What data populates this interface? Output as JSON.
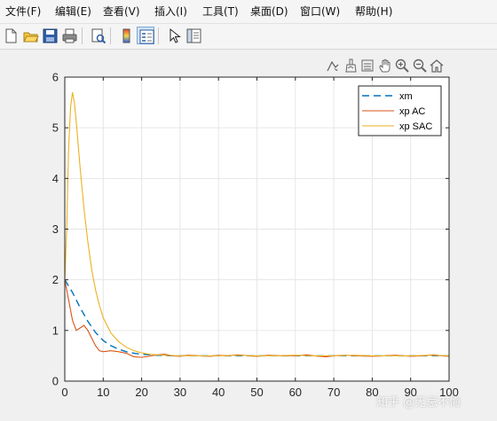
{
  "menu": {
    "items": [
      {
        "label": "文件(F)",
        "name": "menu-file"
      },
      {
        "label": "编辑(E)",
        "name": "menu-edit"
      },
      {
        "label": "查看(V)",
        "name": "menu-view"
      },
      {
        "label": "插入(I)",
        "name": "menu-insert"
      },
      {
        "label": "工具(T)",
        "name": "menu-tools"
      },
      {
        "label": "桌面(D)",
        "name": "menu-desktop"
      },
      {
        "label": "窗口(W)",
        "name": "menu-window"
      },
      {
        "label": "帮助(H)",
        "name": "menu-help"
      }
    ]
  },
  "toolbar": {
    "buttons": [
      "new-figure-icon",
      "open-file-icon",
      "save-icon",
      "print-icon",
      "print-preview-icon",
      "colorbar-icon",
      "legend-icon",
      "pointer-icon",
      "property-inspector-icon"
    ]
  },
  "axes_toolbar": {
    "buttons": [
      "data-cursor-icon",
      "brush-icon",
      "link-data-icon",
      "pan-hand-icon",
      "zoom-in-icon",
      "zoom-out-icon",
      "home-icon"
    ]
  },
  "watermark": {
    "text": "知乎 @无忌不悔"
  },
  "colors": {
    "xm": "#0072bd",
    "xp_ac": "#d95319",
    "xp_sac": "#edb120",
    "grid": "#e6e6e6",
    "axes": "#262626"
  },
  "chart_data": {
    "type": "line",
    "title": "",
    "xlabel": "",
    "ylabel": "",
    "xlim": [
      0,
      100
    ],
    "ylim": [
      0,
      6
    ],
    "xticks": [
      0,
      10,
      20,
      30,
      40,
      50,
      60,
      70,
      80,
      90,
      100
    ],
    "yticks": [
      0,
      1,
      2,
      3,
      4,
      5,
      6
    ],
    "grid": true,
    "legend_position": "top-right",
    "series": [
      {
        "name": "xm",
        "style": "dashed",
        "color": "#0072bd",
        "x": [
          0,
          2,
          4,
          6,
          8,
          10,
          12,
          14,
          16,
          18,
          20,
          22,
          24,
          26,
          28,
          30,
          35,
          40,
          50,
          60,
          70,
          80,
          90,
          100
        ],
        "y": [
          2.0,
          1.75,
          1.45,
          1.18,
          0.96,
          0.8,
          0.7,
          0.63,
          0.58,
          0.55,
          0.53,
          0.52,
          0.51,
          0.505,
          0.5,
          0.5,
          0.5,
          0.5,
          0.5,
          0.5,
          0.5,
          0.5,
          0.5,
          0.5
        ]
      },
      {
        "name": "xp AC",
        "style": "solid",
        "color": "#d95319",
        "x": [
          0,
          1,
          2,
          3,
          4,
          5,
          6,
          7,
          8,
          9,
          10,
          12,
          14,
          16,
          18,
          20,
          22,
          24,
          26,
          28,
          30,
          32,
          35,
          38,
          40,
          42,
          45,
          48,
          50,
          53,
          56,
          60,
          63,
          66,
          68,
          70,
          73,
          76,
          80,
          83,
          86,
          90,
          93,
          96,
          98,
          100
        ],
        "y": [
          2.0,
          1.6,
          1.2,
          1.0,
          1.05,
          1.1,
          1.0,
          0.85,
          0.7,
          0.6,
          0.58,
          0.6,
          0.58,
          0.55,
          0.48,
          0.47,
          0.49,
          0.52,
          0.53,
          0.5,
          0.49,
          0.51,
          0.5,
          0.49,
          0.51,
          0.5,
          0.52,
          0.5,
          0.49,
          0.51,
          0.5,
          0.5,
          0.52,
          0.49,
          0.48,
          0.5,
          0.51,
          0.5,
          0.49,
          0.5,
          0.51,
          0.49,
          0.5,
          0.52,
          0.5,
          0.49
        ]
      },
      {
        "name": "xp SAC",
        "style": "solid",
        "color": "#edb120",
        "x": [
          0,
          0.5,
          1,
          1.5,
          2,
          2.5,
          3,
          4,
          5,
          6,
          7,
          8,
          9,
          10,
          12,
          14,
          16,
          18,
          20,
          22,
          24,
          26,
          28,
          30,
          35,
          40,
          45,
          50,
          55,
          60,
          65,
          70,
          75,
          80,
          85,
          90,
          95,
          100
        ],
        "y": [
          2.0,
          3.0,
          4.6,
          5.4,
          5.7,
          5.5,
          5.1,
          4.2,
          3.4,
          2.75,
          2.2,
          1.8,
          1.5,
          1.25,
          0.95,
          0.78,
          0.67,
          0.6,
          0.56,
          0.53,
          0.52,
          0.51,
          0.505,
          0.5,
          0.5,
          0.5,
          0.51,
          0.5,
          0.5,
          0.51,
          0.5,
          0.5,
          0.51,
          0.5,
          0.5,
          0.5,
          0.51,
          0.5
        ]
      }
    ]
  }
}
